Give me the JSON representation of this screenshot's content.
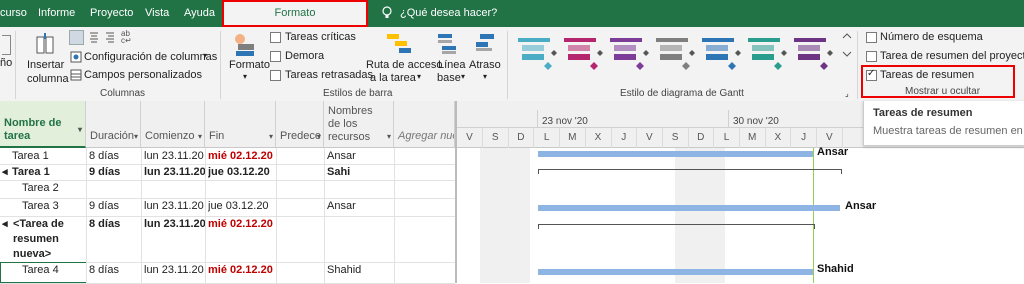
{
  "tabs": [
    "curso",
    "Informe",
    "Proyecto",
    "Vista",
    "Ayuda",
    "Formato",
    "¿Qué desea hacer?"
  ],
  "ribbon": {
    "col_group": {
      "insert_label1": "Insertar",
      "insert_label2": "columna",
      "config_cols": "Configuración de columnas",
      "custom_fields": "Campos personalizados",
      "label": "Columnas",
      "left_cut": "ño"
    },
    "bar_group": {
      "format": "Formato",
      "critical": "Tareas críticas",
      "delay": "Demora",
      "late": "Tareas retrasadas",
      "path1": "Ruta de acceso",
      "path2": "a la tarea",
      "baseline1": "Línea",
      "baseline2": "base",
      "slippage": "Atraso",
      "label": "Estilos de barra"
    },
    "gantt_group": {
      "label": "Estilo de diagrama de Gantt",
      "colors": [
        "#4bacc6",
        "#b4266e",
        "#7d3c98",
        "#7f7f7f",
        "#2e75b6",
        "#2a9d8f",
        "#6c3483"
      ]
    },
    "show_group": {
      "outline": "Número de esquema",
      "project_summary": "Tarea de resumen del proyecto",
      "summary": "Tareas de resumen",
      "label": "Mostrar u ocultar"
    }
  },
  "tooltip": {
    "title": "Tareas de resumen",
    "body": "Muestra tareas de resumen en la vis"
  },
  "grid": {
    "headers": {
      "name1": "Nombre de",
      "name2": "tarea",
      "duration": "Duración",
      "start": "Comienzo",
      "finish": "Fin",
      "pred": "Predece",
      "res1": "Nombres",
      "res2": "de los",
      "res3": "recursos",
      "add": "Agregar nueva"
    },
    "rows": [
      {
        "name": "Tarea 1",
        "dur": "8 días",
        "start": "lun 23.11.20",
        "end": "mié 02.12.20",
        "res": "Ansar"
      },
      {
        "name": "Tarea 1",
        "dur": "9 días",
        "start": "lun 23.11.20",
        "end": "jue 03.12.20",
        "res": "Sahi"
      },
      {
        "name": "Tarea 2",
        "dur": "",
        "start": "",
        "end": "",
        "res": ""
      },
      {
        "name": "Tarea 3",
        "dur": "9 días",
        "start": "lun 23.11.20",
        "end": "jue 03.12.20",
        "res": "Ansar"
      },
      {
        "name1": "<Tarea de",
        "name2": "resumen",
        "name3": "nueva>",
        "dur": "8 días",
        "start": "lun 23.11.20",
        "end": "mié 02.12.20",
        "res": ""
      },
      {
        "name": "Tarea 4",
        "dur": "8 días",
        "start": "lun 23.11.20",
        "end": "mié 02.12.20",
        "res": "Shahid"
      }
    ]
  },
  "timeline": {
    "week1": "23 nov '20",
    "week2": "30 nov '20",
    "days": [
      "V",
      "S",
      "D",
      "L",
      "M",
      "X",
      "J",
      "V",
      "S",
      "D",
      "L",
      "M",
      "X",
      "J",
      "V"
    ],
    "labels": {
      "a": "Ansar",
      "b": "Ansar",
      "c": "Shahid"
    }
  }
}
